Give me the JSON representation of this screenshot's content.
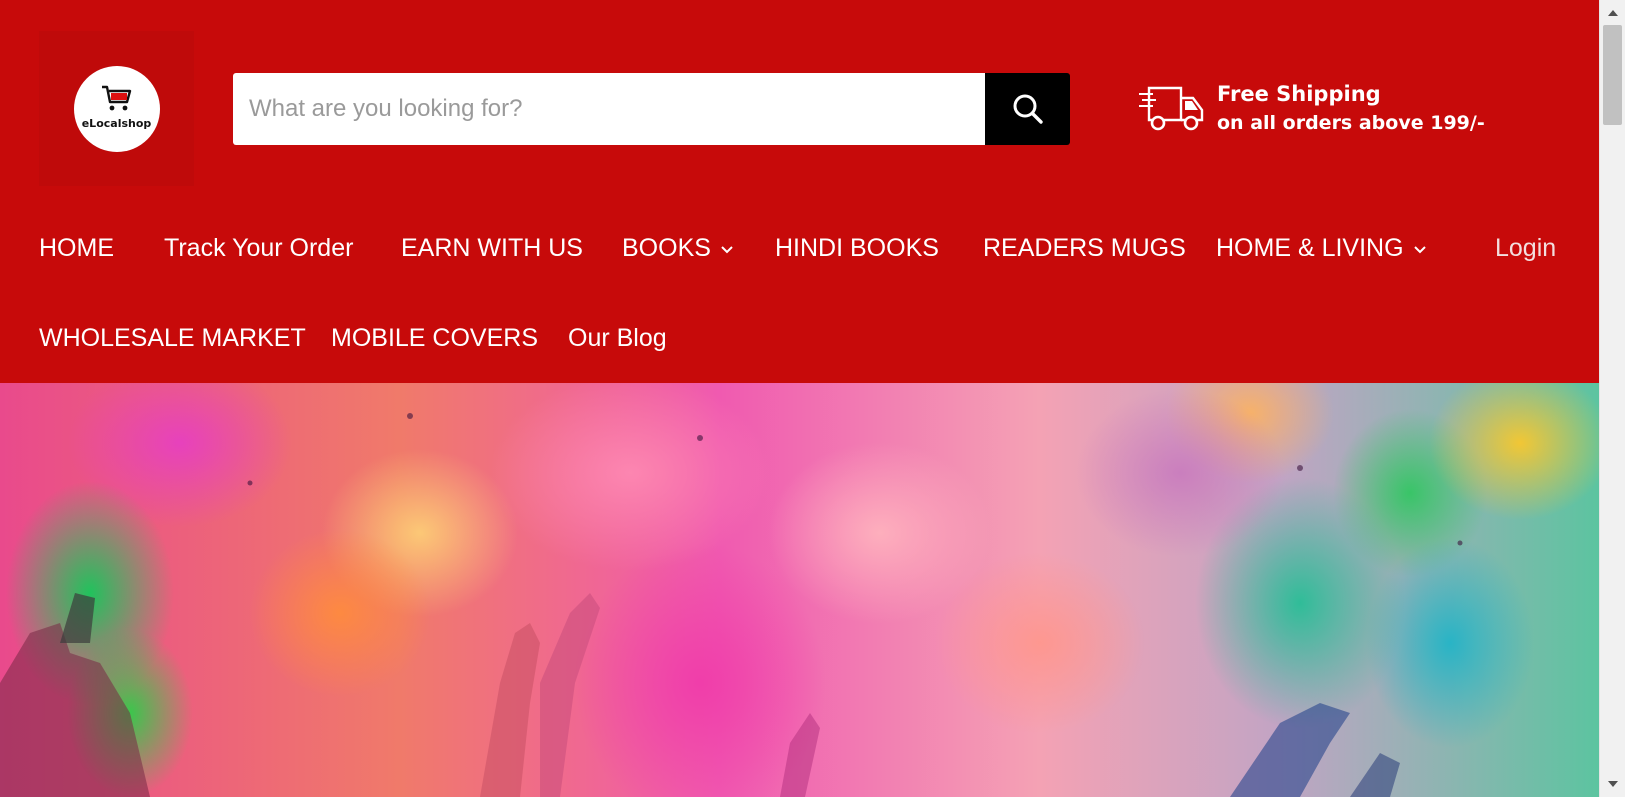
{
  "logo": {
    "text": "eLocalshop",
    "icon": "shopping-cart-icon"
  },
  "search": {
    "placeholder": "What are you looking for?",
    "value": "",
    "button_icon": "search-icon"
  },
  "shipping": {
    "icon": "truck-icon",
    "title": "Free Shipping",
    "subtitle": "on all orders above 199/-"
  },
  "nav": {
    "row1": [
      {
        "label": "HOME",
        "dropdown": false
      },
      {
        "label": "Track Your Order",
        "dropdown": false
      },
      {
        "label": "EARN WITH US",
        "dropdown": false
      },
      {
        "label": "BOOKS",
        "dropdown": true
      },
      {
        "label": "HINDI BOOKS",
        "dropdown": false
      },
      {
        "label": "READERS MUGS",
        "dropdown": false
      },
      {
        "label": "HOME & LIVING",
        "dropdown": true
      }
    ],
    "login": "Login",
    "row2": [
      {
        "label": "WHOLESALE MARKET",
        "dropdown": false
      },
      {
        "label": "MOBILE COVERS",
        "dropdown": false
      },
      {
        "label": "Our Blog",
        "dropdown": false
      }
    ]
  },
  "colors": {
    "header_bg": "#c70a0a",
    "search_button": "#000000",
    "nav_text": "#ffffff"
  }
}
